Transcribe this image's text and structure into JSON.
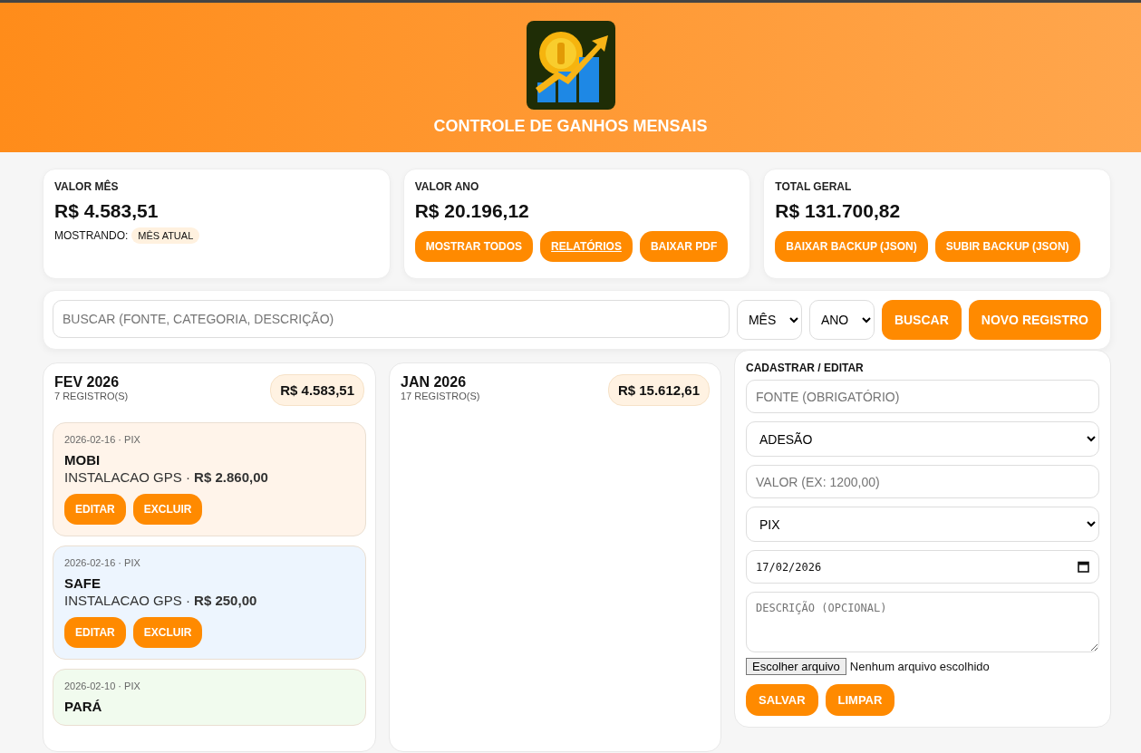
{
  "header": {
    "title": "CONTROLE DE GANHOS MENSAIS"
  },
  "summary": [
    {
      "label": "VALOR MÊS",
      "value": "R$ 4.583,51",
      "showing_label": "MOSTRANDO:",
      "showing_badge": "MÊS ATUAL"
    },
    {
      "label": "VALOR ANO",
      "value": "R$ 20.196,12",
      "buttons": [
        {
          "label": "MOSTRAR TODOS",
          "underlined": false
        },
        {
          "label": "RELATÓRIOS",
          "underlined": true
        },
        {
          "label": "BAIXAR PDF",
          "underlined": false
        }
      ]
    },
    {
      "label": "TOTAL GERAL",
      "value": "R$ 131.700,82",
      "buttons": [
        {
          "label": "BAIXAR BACKUP (JSON)",
          "underlined": false
        },
        {
          "label": "SUBIR BACKUP (JSON)",
          "underlined": false
        }
      ]
    }
  ],
  "search": {
    "placeholder": "BUSCAR (FONTE, CATEGORIA, DESCRIÇÃO)",
    "month": "MÊS",
    "year": "ANO",
    "buttons": [
      "BUSCAR",
      "NOVO REGISTRO"
    ]
  },
  "months": [
    {
      "title": "FEV 2026",
      "count": "7 REGISTRO(S)",
      "total": "R$ 4.583,51",
      "entries": [
        {
          "meta": "2026-02-16 · PIX",
          "name": "MOBI",
          "detail": "INSTALACAO GPS · **R$ 2.860,00**",
          "color": "#fff4ea",
          "buttons": [
            "EDITAR",
            "EXCLUIR"
          ]
        },
        {
          "meta": "2026-02-16 · PIX",
          "name": "SAFE",
          "detail": "INSTALACAO GPS · **R$ 250,00**",
          "color": "#edf5fe",
          "buttons": [
            "EDITAR",
            "EXCLUIR"
          ]
        },
        {
          "meta": "2026-02-10 · PIX",
          "name": "PARÁ",
          "color": "#f1fbee"
        }
      ]
    },
    {
      "title": "JAN 2026",
      "count": "17 REGISTRO(S)",
      "total": "R$ 15.612,61"
    }
  ],
  "form": {
    "title": "CADASTRAR / EDITAR",
    "source_placeholder": "FONTE (OBRIGATÓRIO)",
    "category": "ADESÃO",
    "value_placeholder": "VALOR (EX: 1200,00)",
    "method": "PIX",
    "date": "17/02/2026",
    "description_placeholder": "DESCRIÇÃO (OPCIONAL)",
    "file_button": "Escolher arquivo",
    "file_status": "Nenhum arquivo escolhido",
    "buttons": [
      "SALVAR",
      "LIMPAR"
    ]
  }
}
